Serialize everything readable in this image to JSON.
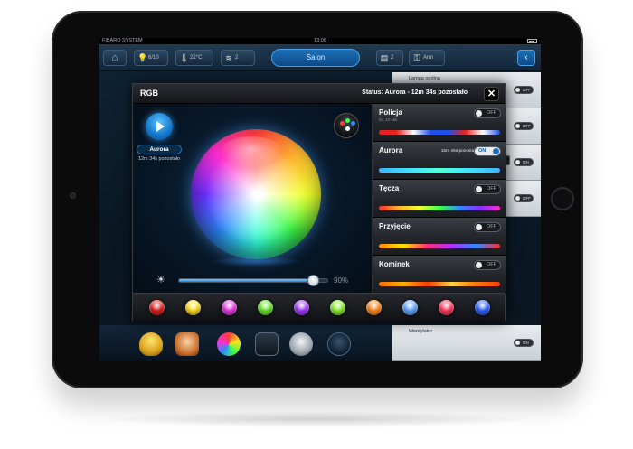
{
  "statusbar": {
    "brand": "FIBARO SYSTEM",
    "time": "13:08"
  },
  "topbar": {
    "items": [
      {
        "icon": "lightbulb-icon",
        "value": "6/10"
      },
      {
        "icon": "thermometer-icon",
        "value": "22°C"
      },
      {
        "icon": "blinds-icon",
        "value": "2"
      },
      {
        "icon": "shutter-icon",
        "value": "2"
      },
      {
        "icon": "alarm-icon",
        "value": "Arm"
      }
    ],
    "room": "Salon"
  },
  "background_list": {
    "rows": [
      {
        "label": "Lampa ogólna",
        "toggle": "OFF"
      },
      {
        "label": "",
        "toggle": "OFF"
      },
      {
        "label": "",
        "toggle": "ON"
      },
      {
        "label": "",
        "toggle": "OFF"
      },
      {
        "label": "Wentylator",
        "toggle": "ON"
      }
    ]
  },
  "modal": {
    "title": "RGB",
    "status": "Status: Aurora - 12m 34s pozostało",
    "close_label": "✕",
    "current_program": "Aurora",
    "current_remaining": "12m 34s pozostało",
    "brightness_percent": 90,
    "brightness_label": "90%",
    "programs": [
      {
        "name": "Policja",
        "subtitle": "5s, 10 sek",
        "remaining": "",
        "state": "OFF",
        "strip": [
          "#e82323",
          "#e82323",
          "#ffffff",
          "#1f4fe8",
          "#1f4fe8",
          "#e82323",
          "#ffffff",
          "#1f4fe8"
        ]
      },
      {
        "name": "Aurora",
        "subtitle": "",
        "remaining": "15m 45s pozostało",
        "state": "ON",
        "strip": [
          "#3fb4ff",
          "#44e0ff",
          "#53ffd8",
          "#44e0ff",
          "#3fb4ff"
        ]
      },
      {
        "name": "Tęcza",
        "subtitle": "",
        "remaining": "",
        "state": "OFF",
        "strip": [
          "#ff2e2e",
          "#ffb52e",
          "#f2ff2e",
          "#3dff4a",
          "#2e8bff",
          "#8a2eff",
          "#ff2ed2"
        ]
      },
      {
        "name": "Przyjęcie",
        "subtitle": "",
        "remaining": "",
        "state": "OFF",
        "strip": [
          "#ff8a00",
          "#ffe300",
          "#ff2e7a",
          "#b42eff",
          "#2e8bff",
          "#ff2e2e"
        ]
      },
      {
        "name": "Kominek",
        "subtitle": "",
        "remaining": "",
        "state": "OFF",
        "strip": [
          "#ff6a00",
          "#ffb000",
          "#ff3b00",
          "#ffd23b",
          "#ff7a00",
          "#ff3b00"
        ]
      }
    ],
    "swatches": [
      "#e21f1f",
      "#ffe11f",
      "#e93be3",
      "#67e52f",
      "#a23bff",
      "#8ff02f",
      "#ff8a1f",
      "#5fa8ff",
      "#ff3b5e",
      "#2f62ff"
    ]
  },
  "dock": {
    "icons": [
      "lightbulb-icon",
      "alarm-sensor-icon",
      "rgb-icon",
      "door-icon",
      "camera-icon",
      "user-icon"
    ]
  }
}
